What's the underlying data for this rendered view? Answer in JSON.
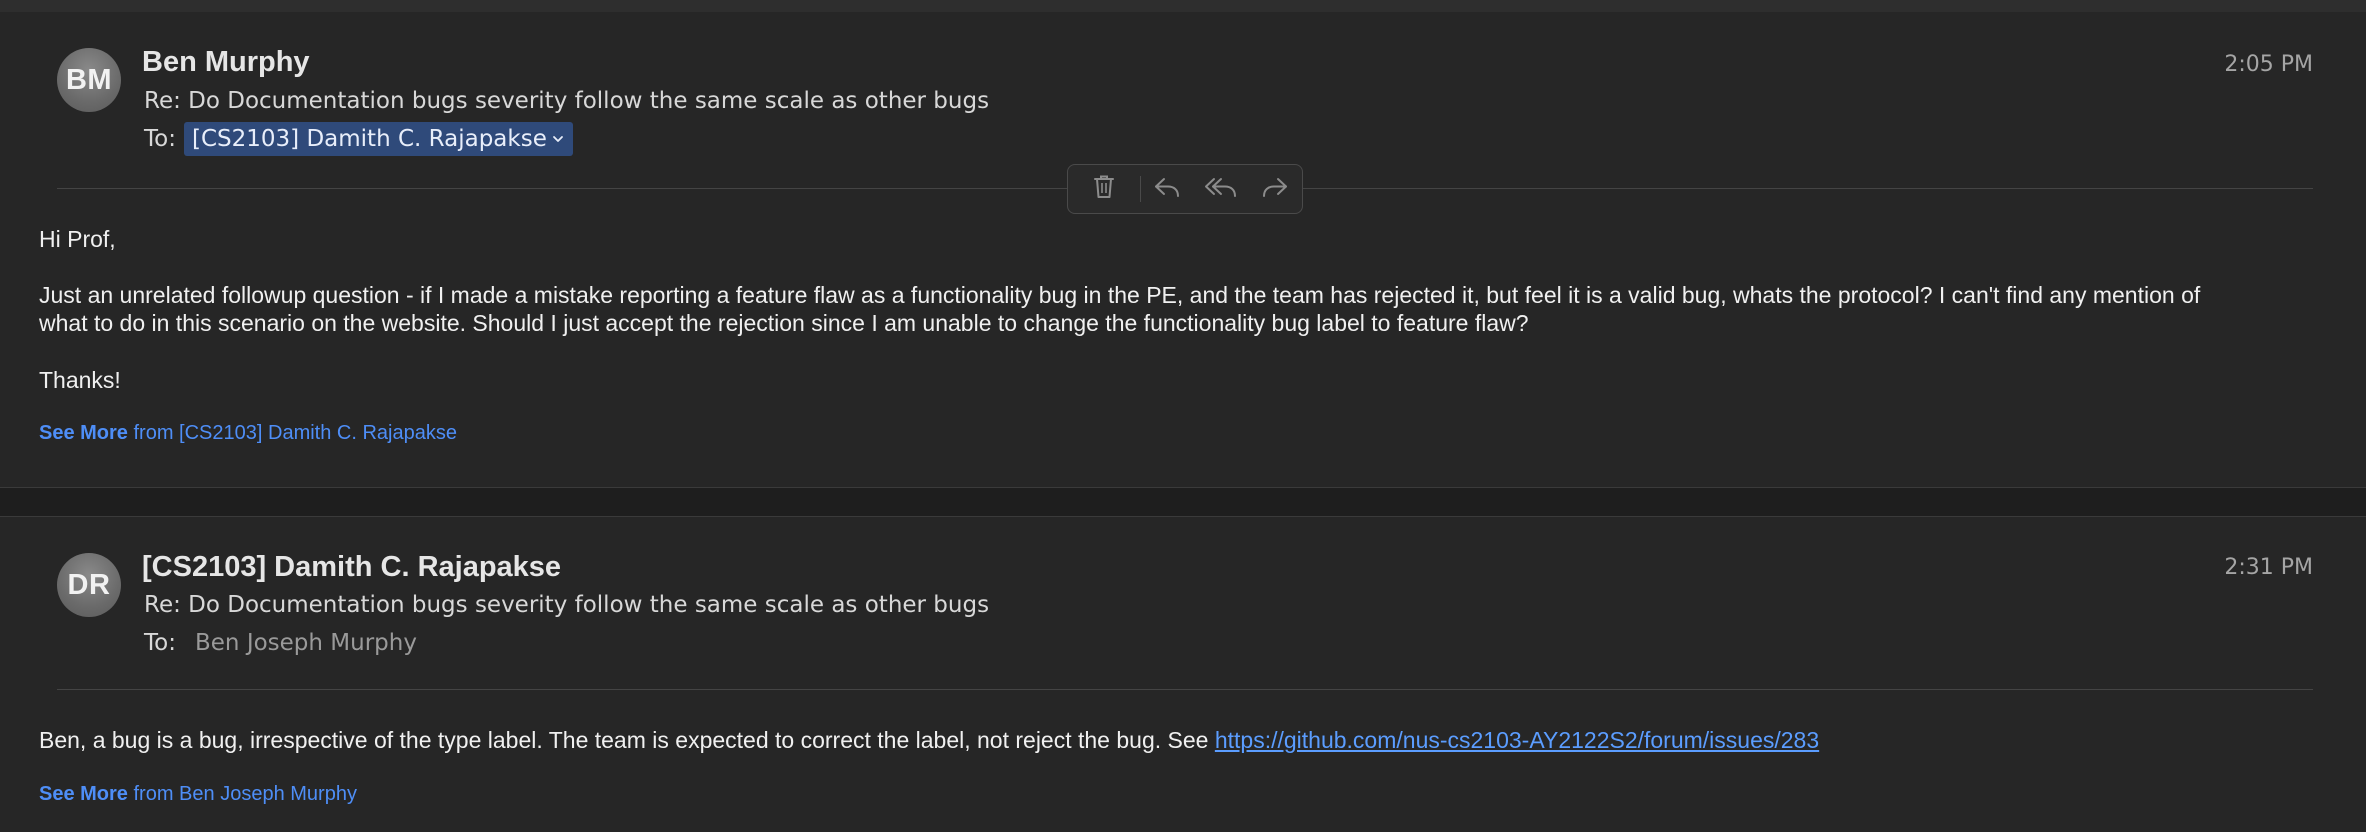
{
  "messages": [
    {
      "avatar_initials": "BM",
      "sender": "Ben Murphy",
      "time": "2:05 PM",
      "subject": "Re: Do Documentation bugs severity follow the same scale as other bugs",
      "to_label": "To:",
      "recipient": "[CS2103] Damith C. Rajapakse",
      "body": {
        "greeting": "Hi Prof,",
        "para1_line1": "Just an unrelated followup question - if I made a mistake reporting a feature flaw as a functionality bug in the PE, and the team has rejected it, but feel it is a valid bug, whats the protocol? I can't find any mention of",
        "para1_line2": "what to do in this scenario on the website. Should I just accept the rejection since I am unable to change the functionality bug label to feature flaw?",
        "signoff": "Thanks!"
      },
      "see_more": {
        "label": "See More",
        "from_text": "from [CS2103] Damith C. Rajapakse"
      }
    },
    {
      "avatar_initials": "DR",
      "sender": "[CS2103] Damith C. Rajapakse",
      "time": "2:31 PM",
      "subject": "Re: Do Documentation bugs severity follow the same scale as other bugs",
      "to_label": "To:",
      "recipient": "Ben Joseph Murphy",
      "body": {
        "text": "Ben, a bug is a bug, irrespective of the type label. The team is expected to correct the label, not reject the bug. See ",
        "link": "https://github.com/nus-cs2103-AY2122S2/forum/issues/283"
      },
      "see_more": {
        "label": "See More",
        "from_text": "from Ben Joseph Murphy"
      }
    }
  ],
  "toolbar": {
    "icons": [
      "trash-icon",
      "reply-icon",
      "reply-all-icon",
      "forward-icon"
    ]
  },
  "colors": {
    "background": "#232323",
    "link": "#5b9dff",
    "chip": "#2f4a7a",
    "text": "#f0f0f0"
  }
}
